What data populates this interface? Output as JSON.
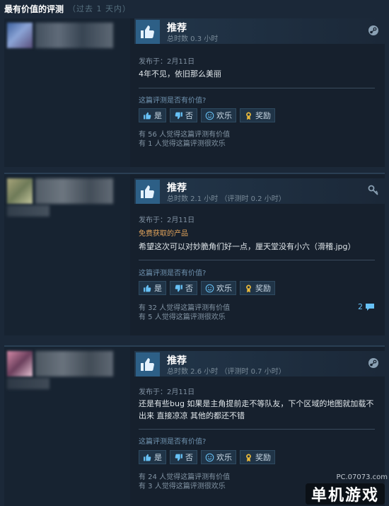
{
  "header": {
    "title": "最有价值的评测",
    "subtitle": "（过去 1 天内）"
  },
  "reviews": [
    {
      "recommend": "推荐",
      "hours": "总时数 0.3 小时",
      "posted": "发布于：2月11日",
      "free": "",
      "text": "4年不见，依旧那么美丽",
      "helpful_q": "这篇评测是否有价值?",
      "buttons": {
        "yes": "是",
        "no": "否",
        "funny": "欢乐",
        "award": "奖励"
      },
      "stat_helpful": "有 56 人觉得这篇评测有价值",
      "stat_funny": "有 1 人觉得这篇评测很欢乐",
      "comments": "",
      "corner_icon": "steam-icon"
    },
    {
      "recommend": "推荐",
      "hours": "总时数 2.1 小时 （评测时 0.2 小时）",
      "posted": "发布于：2月11日",
      "free": "免费获取的产品",
      "text": "希望这次可以对妙脆角们好一点，厘天堂没有小六（滑稽.jpg）",
      "helpful_q": "这篇评测是否有价值?",
      "buttons": {
        "yes": "是",
        "no": "否",
        "funny": "欢乐",
        "award": "奖励"
      },
      "stat_helpful": "有 32 人觉得这篇评测有价值",
      "stat_funny": "有 5 人觉得这篇评测很欢乐",
      "comments": "2",
      "corner_icon": "key-icon"
    },
    {
      "recommend": "推荐",
      "hours": "总时数 2.6 小时 （评测时 0.7 小时）",
      "posted": "发布于：2月11日",
      "free": "",
      "text": "还是有些bug 如果是主角提前走不等队友，下个区域的地图就加载不出来 直接凉凉 其他的都还不错",
      "helpful_q": "这篇评测是否有价值?",
      "buttons": {
        "yes": "是",
        "no": "否",
        "funny": "欢乐",
        "award": "奖励"
      },
      "stat_helpful": "有 24 人觉得这篇评测有价值",
      "stat_funny": "有 3 人觉得这篇评测很欢乐",
      "comments": "",
      "corner_icon": "steam-icon"
    }
  ],
  "watermark": {
    "small": "PC.07073.com",
    "big": "单机游戏"
  }
}
